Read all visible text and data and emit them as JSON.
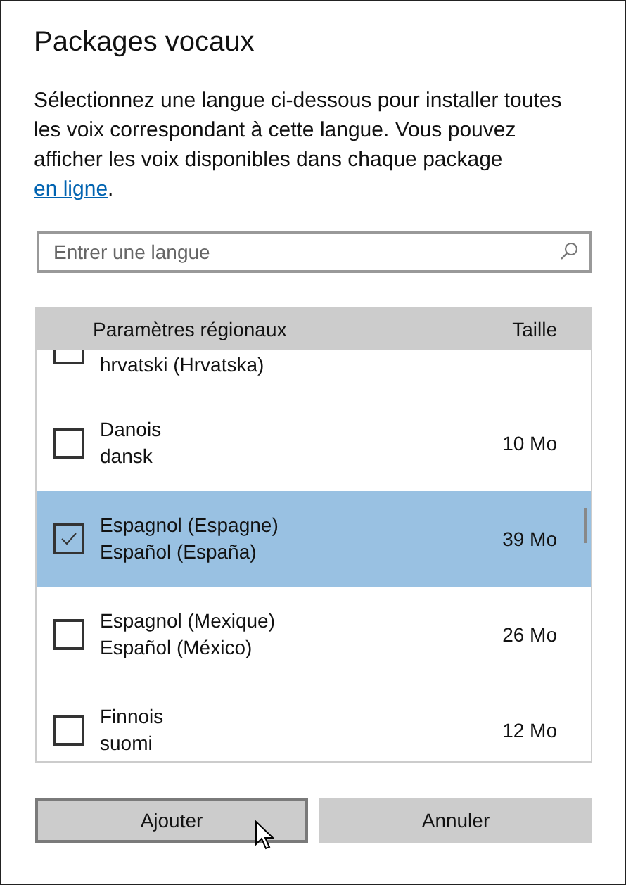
{
  "dialog": {
    "title": "Packages vocaux",
    "description": "Sélectionnez une langue ci-dessous pour installer toutes les voix correspondant à cette langue. Vous pouvez afficher les voix disponibles dans chaque package ",
    "link": "en ligne",
    "description_end": "."
  },
  "search": {
    "placeholder": "Entrer une langue"
  },
  "table": {
    "columns": [
      "Paramètres régionaux",
      "Taille"
    ],
    "rows": [
      {
        "kind": "partial",
        "name_local": "hrvatski (Hrvatska)",
        "selected": false
      },
      {
        "kind": "full",
        "name": "Danois",
        "name_local": "dansk",
        "size": "10 Mo",
        "checked": false,
        "selected": false
      },
      {
        "kind": "full",
        "name": "Espagnol (Espagne)",
        "name_local": "Español (España)",
        "size": "39 Mo",
        "checked": true,
        "selected": true
      },
      {
        "kind": "full",
        "name": "Espagnol (Mexique)",
        "name_local": "Español (México)",
        "size": "26 Mo",
        "checked": false,
        "selected": false
      },
      {
        "kind": "full",
        "name": "Finnois",
        "name_local": "suomi",
        "size": "12 Mo",
        "checked": false,
        "selected": false
      }
    ]
  },
  "buttons": [
    {
      "label": "Ajouter",
      "focused": true
    },
    {
      "label": "Annuler",
      "focused": false
    }
  ]
}
